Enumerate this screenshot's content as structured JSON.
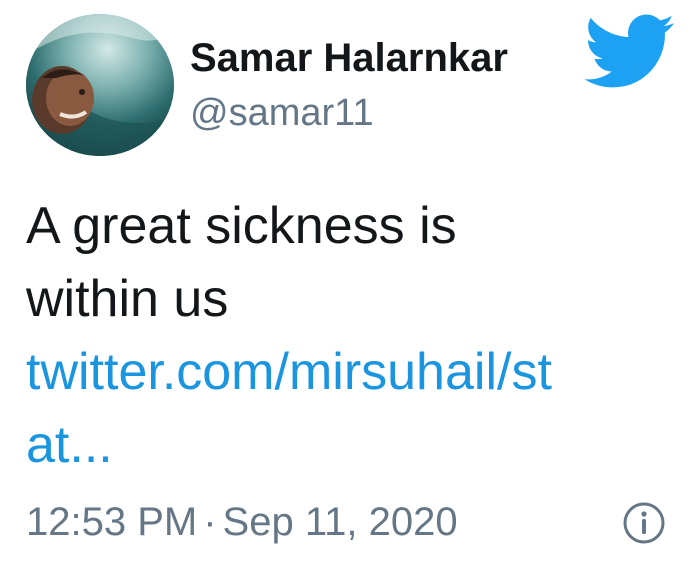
{
  "author": {
    "display_name": "Samar Halarnkar",
    "handle": "@samar11",
    "avatar_icon": "profile-photo"
  },
  "brand": {
    "icon": "twitter-bird-icon",
    "color": "#1da1f2"
  },
  "tweet": {
    "text_line_1": "A great sickness is",
    "text_line_2": "within us",
    "link_line_1": "twitter.com/mirsuhail/st",
    "link_line_2": "at...",
    "link_color": "#1b95e0"
  },
  "meta": {
    "time": "12:53 PM",
    "separator": "·",
    "date": "Sep 11, 2020",
    "info_icon": "info-icon"
  }
}
